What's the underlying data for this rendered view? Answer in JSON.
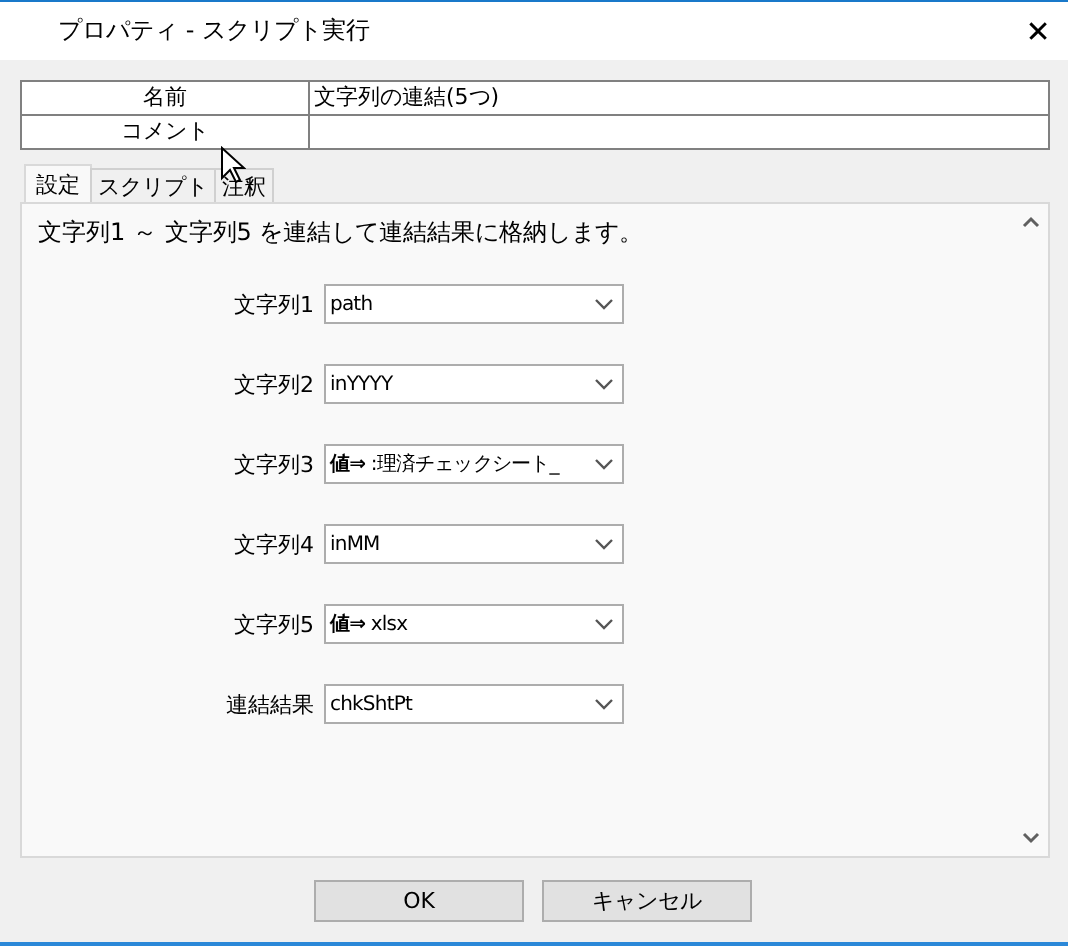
{
  "window": {
    "title": "プロパティ - スクリプト実行",
    "close": "✕"
  },
  "properties": [
    {
      "label": "名前",
      "value": "文字列の連結(5つ)"
    },
    {
      "label": "コメント"
    }
  ],
  "tabs": [
    {
      "label": "設定",
      "selected": true
    },
    {
      "label": "スクリプト",
      "selected": false
    },
    {
      "label": "注釈",
      "selected": false
    }
  ],
  "description": "文字列1 ～ 文字列5 を連結して連結結果に格納します。",
  "fields": [
    {
      "label": "文字列1",
      "value": "path"
    },
    {
      "label": "文字列2",
      "value": "inYYYY"
    },
    {
      "label": "文字列3",
      "value": "**値⇒** :理済チェックシート_"
    },
    {
      "label": "文字列4",
      "value": "inMM"
    },
    {
      "label": "文字列5",
      "value": "**値⇒** xlsx"
    },
    {
      "label": "連結結果",
      "value": "chkShtPt"
    }
  ],
  "buttons": [
    "OK",
    "キャンセル"
  ]
}
